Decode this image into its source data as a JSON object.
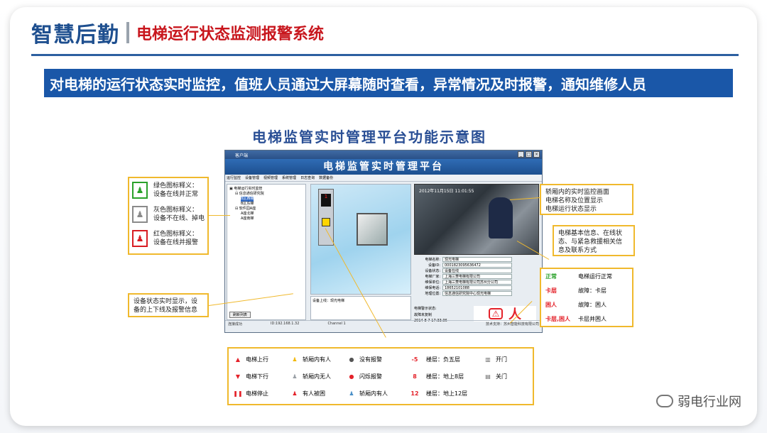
{
  "header": {
    "title": "智慧后勤",
    "subtitle": "电梯运行状态监测报警系统"
  },
  "banner": "对电梯的运行状态实时监控，值班人员通过大屏幕随时查看，异常情况及时报警，通知维修人员",
  "figure": {
    "title": "电梯监管实时管理平台功能示意图",
    "app": {
      "window_title": "客户端",
      "banner": "电梯监管实时管理平台",
      "menu": [
        "运行监控",
        "设备管理",
        "视频管理",
        "系统管理",
        "日志查询",
        "数据备份"
      ],
      "tree": [
        "电梯运行实时监管",
        "信息通信研究院",
        "B区西梯",
        "B区东梯",
        "软件园A座",
        "A座北梯",
        "A座南梯"
      ],
      "tree_selected": "B区西梯",
      "refresh_button": "刷新列表",
      "status_bar": [
        "连接成功",
        "ID:192.168.1.32",
        "Channel 1"
      ],
      "floor_display": "1",
      "device_info_label": "设备上线：现光电梯",
      "video_timestamp": "2012年11月15日 11:01:55",
      "info_rows": [
        {
          "k": "电梯名称:",
          "v": "现光电梯"
        },
        {
          "k": "设备ID:",
          "v": "0001823095636472"
        },
        {
          "k": "设备状态:",
          "v": "设备在线"
        },
        {
          "k": "电梯厂家:",
          "v": "上海三菱电梯有限公司"
        },
        {
          "k": "维保单位:",
          "v": "上海三菱电梯有限公司苏州分公司"
        },
        {
          "k": "维保电话:",
          "v": "18652101088"
        },
        {
          "k": "地理位置:",
          "v": "信息通信研究院中心现光电梯"
        }
      ],
      "alarm_label": "电梯警示状态:",
      "alarm_sub": "故障未复制",
      "alarm_time": "2014-8-7 17:33:36",
      "footer_right": "技术支持：苏州智能科技有限公司"
    },
    "left_legend": [
      {
        "icon": "green-person-icon",
        "color": "#2aa12a",
        "line1": "绿色图标释义：",
        "line2": "设备在线并正常"
      },
      {
        "icon": "gray-person-icon",
        "color": "#8a8a8a",
        "line1": "灰色图标释义：",
        "line2": "设备不在线、掉电"
      },
      {
        "icon": "red-person-icon",
        "color": "#d81c22",
        "line1": "红色图标释义：",
        "line2": "设备在线并报警"
      }
    ],
    "left_callout": [
      "设备状态实时显示，设",
      "备的上下线及报警信息"
    ],
    "right_callout_1": [
      "轿厢内的实时监控画面",
      "电梯名称及位置显示",
      "电梯运行状态显示"
    ],
    "right_callout_2": [
      "电梯基本信息、在线状",
      "态、与紧急救援相关信",
      "息及联系方式"
    ],
    "status_legend": [
      {
        "tag": "正常",
        "text": "电梯运行正常"
      },
      {
        "tag": "卡层",
        "text": "故障：卡层"
      },
      {
        "tag": "困人",
        "text": "故障：困人"
      },
      {
        "tag": "卡层,困人",
        "text": "卡层并困人"
      }
    ],
    "bottom_legend": [
      {
        "glyph": "▲",
        "color": "#e4222a",
        "text": "电梯上行"
      },
      {
        "glyph": "▼",
        "color": "#e4222a",
        "text": "电梯下行"
      },
      {
        "glyph": "❚❚",
        "color": "#e4222a",
        "text": "电梯停止"
      },
      {
        "glyph": "♟",
        "color": "#f2b90f",
        "text": "轿厢内有人"
      },
      {
        "glyph": "♟",
        "color": "#9aa0a6",
        "text": "轿厢内无人"
      },
      {
        "glyph": "♟",
        "color": "#e4222a",
        "text": "有人被困"
      },
      {
        "glyph": "●",
        "color": "#555555",
        "text": "没有报警"
      },
      {
        "glyph": "●",
        "color": "#e4222a",
        "text": "闪烁报警"
      },
      {
        "glyph": "♟",
        "color": "#4a90c8",
        "text": "轿厢内有人"
      },
      {
        "glyph": "-5",
        "color": "#e4222a",
        "text": "楼层：负五层"
      },
      {
        "glyph": "8",
        "color": "#e4222a",
        "text": "楼层：地上8层"
      },
      {
        "glyph": "12",
        "color": "#e4222a",
        "text": "楼层：地上12层"
      },
      {
        "glyph": "▥",
        "color": "#666666",
        "text": "开门"
      },
      {
        "glyph": "▤",
        "color": "#666666",
        "text": "关门"
      }
    ]
  },
  "watermark": "弱电行业网"
}
